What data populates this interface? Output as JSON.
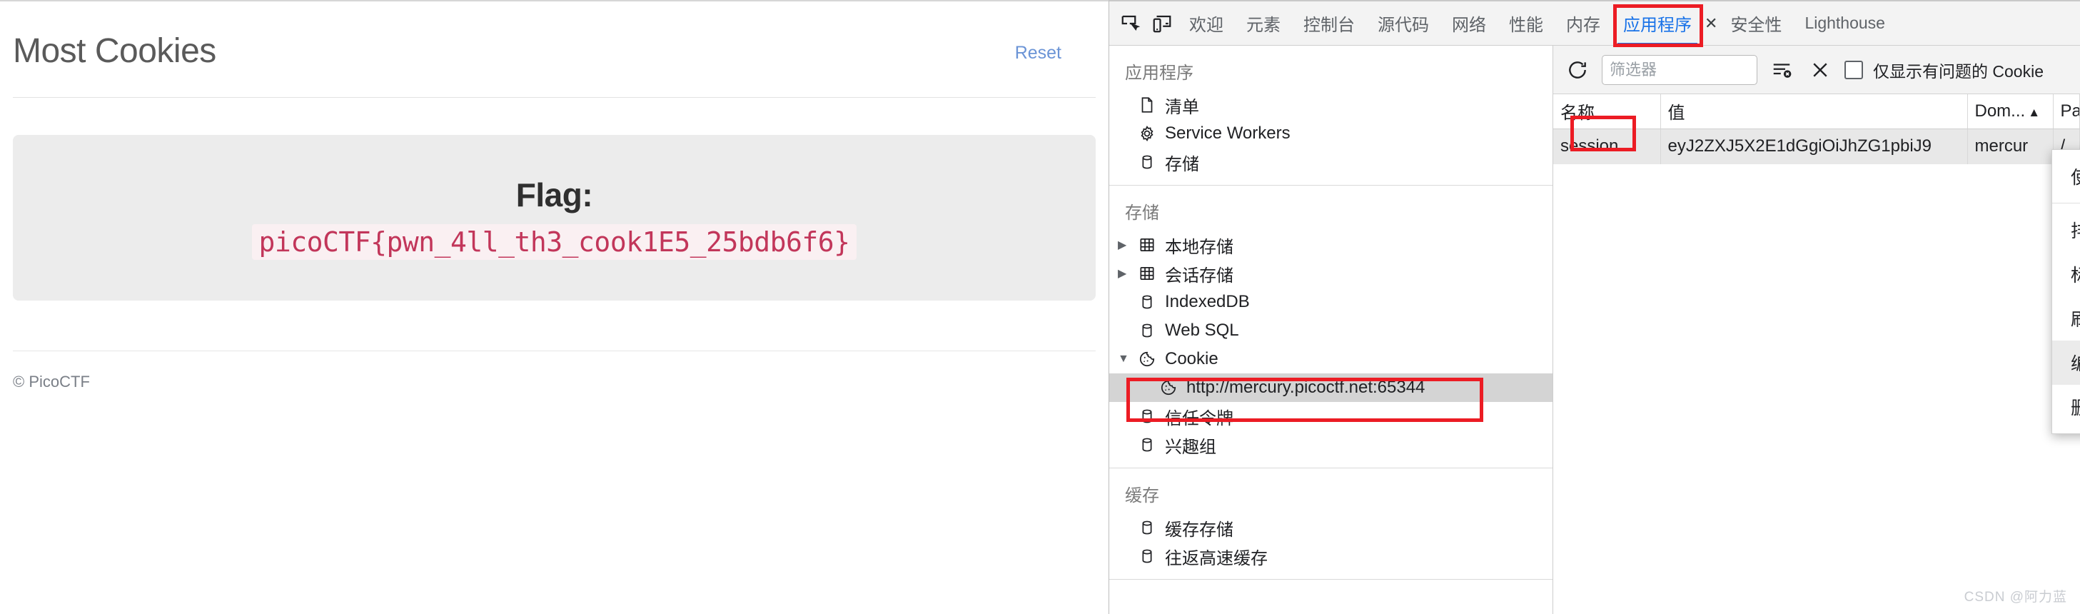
{
  "webpage": {
    "title": "Most Cookies",
    "reset_label": "Reset",
    "flag_label": "Flag:",
    "flag_value": "picoCTF{pwn_4ll_th3_cook1E5_25bdb6f6}",
    "footer": "© PicoCTF"
  },
  "devtools": {
    "tabs": [
      {
        "label": "欢迎",
        "active": false
      },
      {
        "label": "元素",
        "active": false
      },
      {
        "label": "控制台",
        "active": false
      },
      {
        "label": "源代码",
        "active": false
      },
      {
        "label": "网络",
        "active": false
      },
      {
        "label": "性能",
        "active": false
      },
      {
        "label": "内存",
        "active": false
      },
      {
        "label": "应用程序",
        "active": true
      },
      {
        "label": "安全性",
        "active": false
      },
      {
        "label": "Lighthouse",
        "active": false
      }
    ],
    "tab_close_glyph": "✕",
    "sidebar": {
      "sections": [
        {
          "heading": "应用程序",
          "items": [
            {
              "label": "清单",
              "icon": "manifest-icon",
              "twisty": "",
              "selected": false,
              "child": false
            },
            {
              "label": "Service Workers",
              "icon": "gear-icon",
              "twisty": "",
              "selected": false,
              "child": false
            },
            {
              "label": "存储",
              "icon": "database-icon",
              "twisty": "",
              "selected": false,
              "child": false
            }
          ]
        },
        {
          "heading": "存储",
          "items": [
            {
              "label": "本地存储",
              "icon": "table-icon",
              "twisty": "▶",
              "selected": false,
              "child": false
            },
            {
              "label": "会话存储",
              "icon": "table-icon",
              "twisty": "▶",
              "selected": false,
              "child": false
            },
            {
              "label": "IndexedDB",
              "icon": "database-icon",
              "twisty": "",
              "selected": false,
              "child": false
            },
            {
              "label": "Web SQL",
              "icon": "database-icon",
              "twisty": "",
              "selected": false,
              "child": false
            },
            {
              "label": "Cookie",
              "icon": "cookie-icon",
              "twisty": "▼",
              "selected": false,
              "child": false
            },
            {
              "label": "http://mercury.picoctf.net:65344",
              "icon": "cookie-icon",
              "twisty": "",
              "selected": true,
              "child": true
            },
            {
              "label": "信任令牌",
              "icon": "database-icon",
              "twisty": "",
              "selected": false,
              "child": false
            },
            {
              "label": "兴趣组",
              "icon": "database-icon",
              "twisty": "",
              "selected": false,
              "child": false
            }
          ]
        },
        {
          "heading": "缓存",
          "items": [
            {
              "label": "缓存存储",
              "icon": "database-icon",
              "twisty": "",
              "selected": false,
              "child": false
            },
            {
              "label": "往返高速缓存",
              "icon": "database-icon",
              "twisty": "",
              "selected": false,
              "child": false
            }
          ]
        }
      ]
    },
    "cookie_toolbar": {
      "refresh_icon": "refresh-icon",
      "filter_placeholder": "筛选器",
      "filter_value": "",
      "clear_filter_icon": "clear-filter-icon",
      "clear_all_icon": "close-x-icon",
      "checkbox_label": "仅显示有问题的 Cookie",
      "checkbox_checked": false
    },
    "cookie_table": {
      "columns": [
        "名称",
        "值",
        "Dom...",
        "Path"
      ],
      "sort_column": "Dom...",
      "sort_arrow": "▲",
      "rows": [
        {
          "名称": "session",
          "值": "eyJ2ZXJ5X2E1dGgiOiJhZG1pbiJ9",
          "Dom...": "mercur",
          "Path": "/"
        }
      ]
    },
    "context_menu": {
      "items": [
        {
          "label": "使用此 Cookie 显示请求",
          "submenu": false,
          "highlighted": false,
          "separator_after": true
        },
        {
          "label": "排序方式",
          "submenu": true,
          "highlighted": false,
          "separator_after": false
        },
        {
          "label": "标题选项",
          "submenu": true,
          "highlighted": false,
          "separator_after": false
        },
        {
          "label": "刷新",
          "submenu": false,
          "highlighted": false,
          "separator_after": false
        },
        {
          "label": "编辑 “值”",
          "submenu": false,
          "highlighted": true,
          "separator_after": false
        },
        {
          "label": "删除",
          "submenu": false,
          "highlighted": false,
          "separator_after": false
        }
      ],
      "submenu_arrow": "›"
    },
    "watermark": "CSDN @阿力蓝",
    "accent_color": "#1a73e8",
    "highlight_box_color": "#ec1c24"
  }
}
